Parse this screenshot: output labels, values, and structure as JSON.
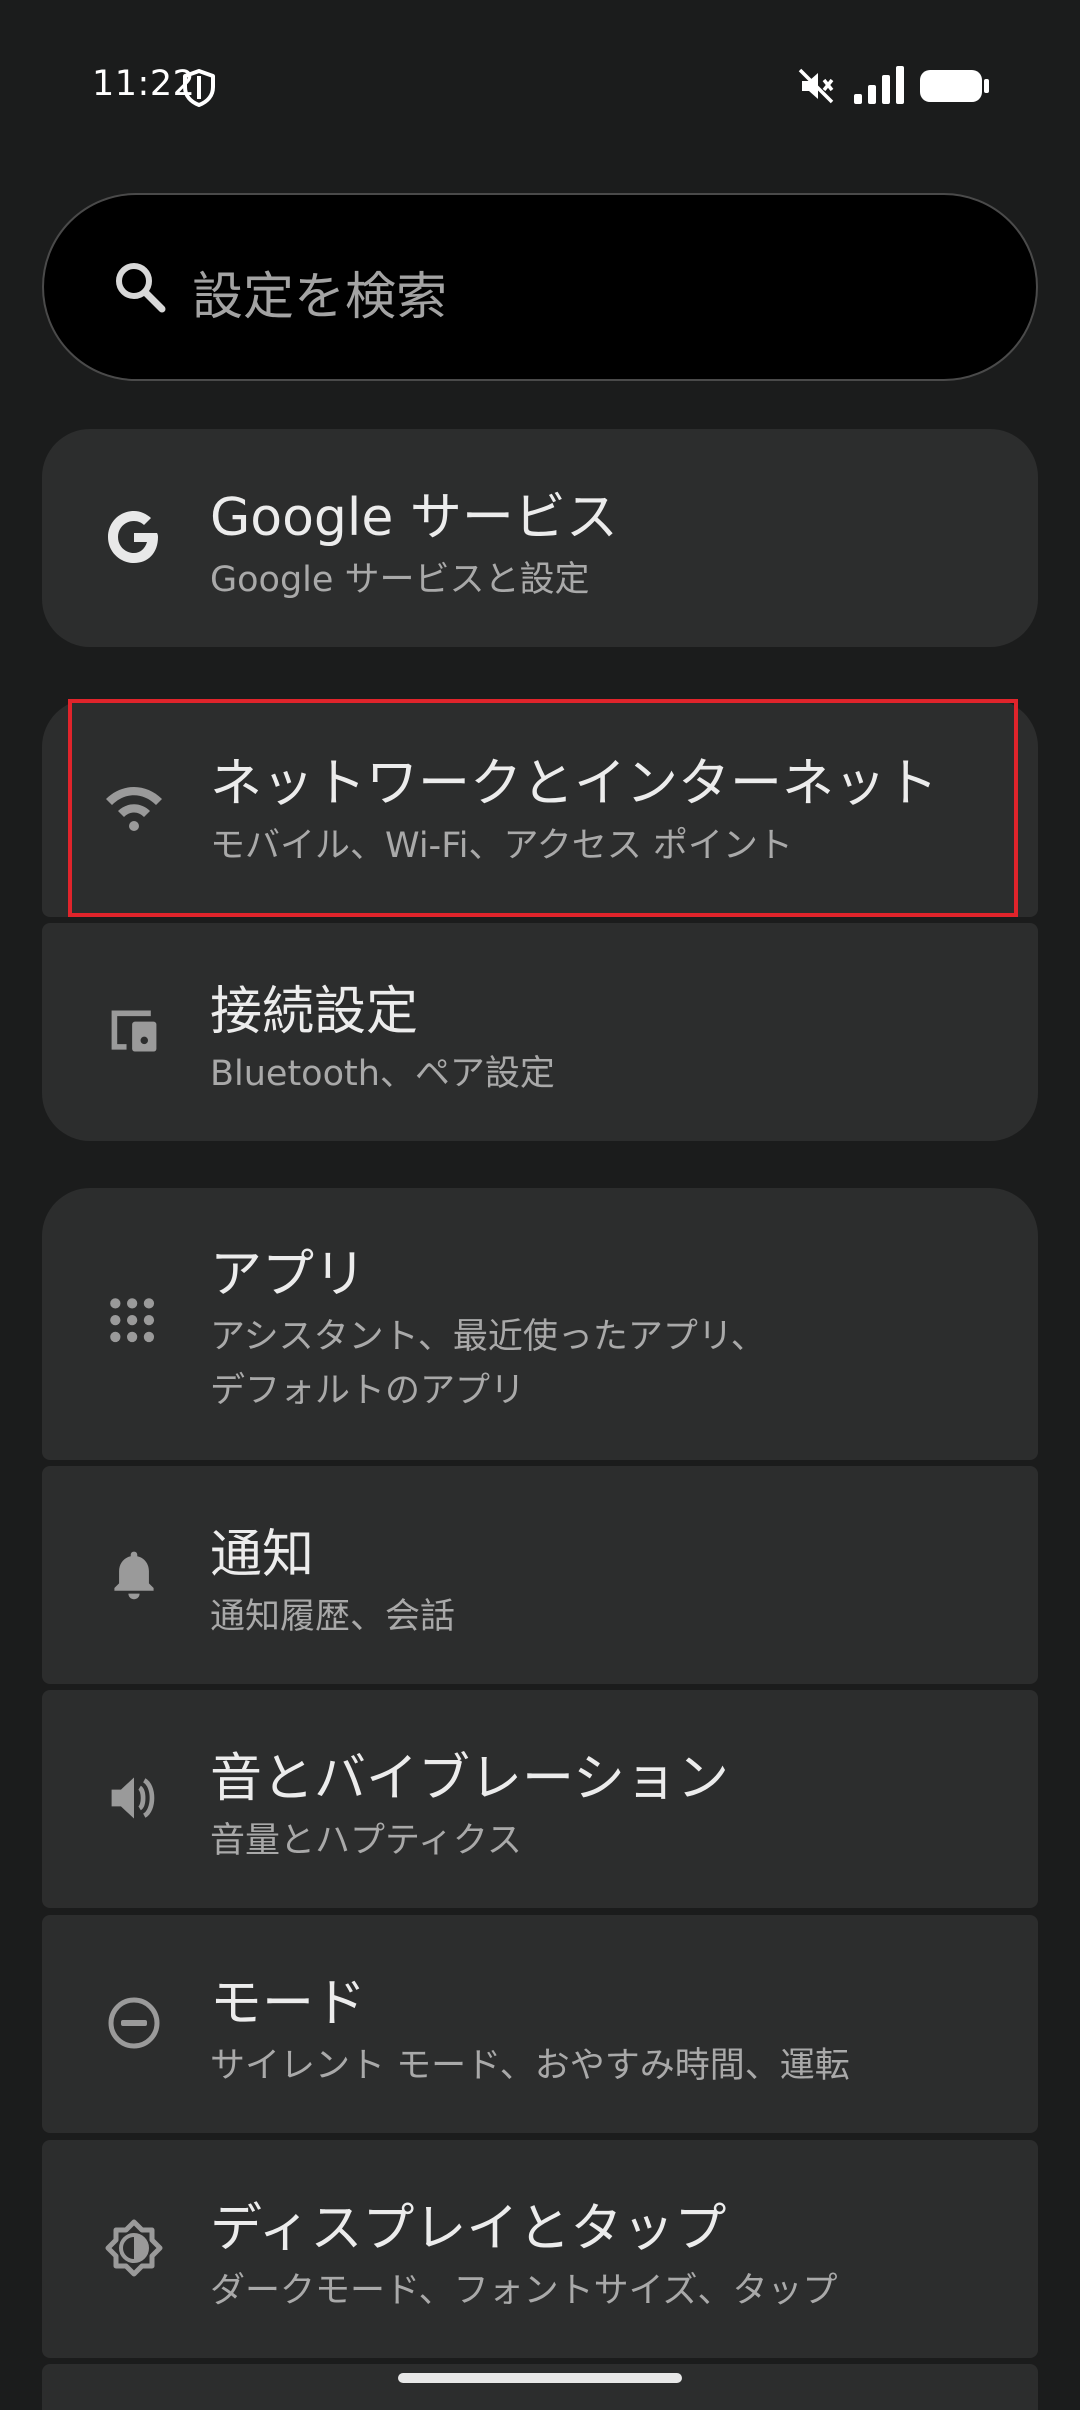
{
  "status_bar": {
    "time": "11:22"
  },
  "search": {
    "placeholder": "設定を検索"
  },
  "items": [
    {
      "title": "Google サービス",
      "subtitle": "Google サービスと設定",
      "icon": "google-g-icon"
    },
    {
      "title": "ネットワークとインターネット",
      "subtitle": "モバイル、Wi-Fi、アクセス ポイント",
      "icon": "wifi-icon"
    },
    {
      "title": "接続設定",
      "subtitle": "Bluetooth、ペア設定",
      "icon": "connected-devices-icon"
    },
    {
      "title": "アプリ",
      "subtitle_line1": "アシスタント、最近使ったアプリ、",
      "subtitle_line2": "デフォルトのアプリ",
      "icon": "apps-grid-icon"
    },
    {
      "title": "通知",
      "subtitle": "通知履歴、会話",
      "icon": "bell-icon"
    },
    {
      "title": "音とバイブレーション",
      "subtitle": "音量とハプティクス",
      "icon": "volume-icon"
    },
    {
      "title": "モード",
      "subtitle": "サイレント モード、おやすみ時間、運転",
      "icon": "do-not-disturb-icon"
    },
    {
      "title": "ディスプレイとタップ",
      "subtitle": "ダークモード、フォントサイズ、タップ",
      "icon": "brightness-icon"
    }
  ],
  "colors": {
    "background": "#1b1c1c",
    "card": "#2c2d2d",
    "search_background": "#000000",
    "highlight_border": "#e0242b",
    "text_primary": "#ececec",
    "text_secondary": "#a9a9a9"
  }
}
